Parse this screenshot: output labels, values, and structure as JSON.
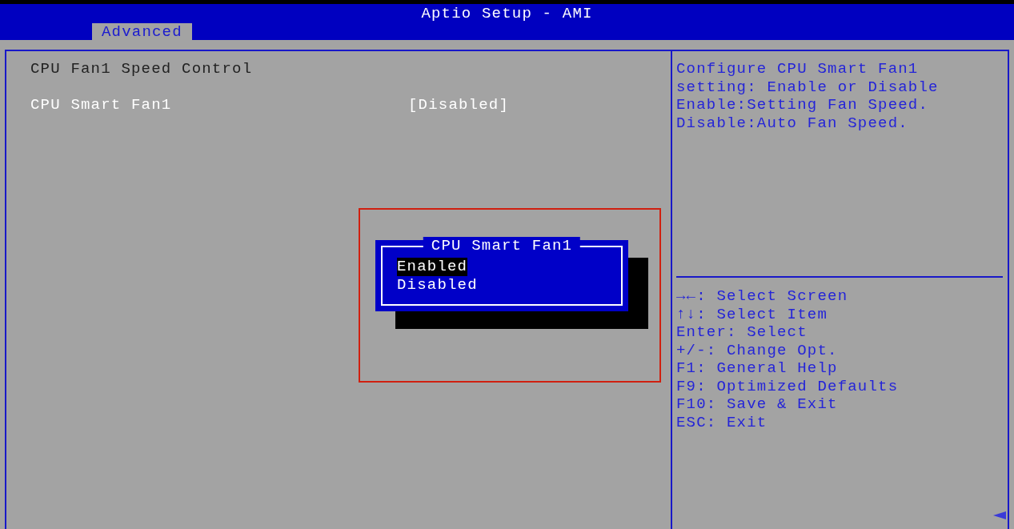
{
  "window": {
    "title": "Aptio Setup - AMI"
  },
  "tabs": [
    {
      "label": "Advanced",
      "selected": true
    }
  ],
  "main": {
    "heading": "CPU Fan1 Speed Control",
    "settings": [
      {
        "label": "CPU Smart Fan1",
        "value": "[Disabled]"
      }
    ]
  },
  "popup": {
    "title": "CPU Smart Fan1",
    "options": [
      {
        "label": "Enabled",
        "selected": true
      },
      {
        "label": "Disabled",
        "selected": false
      }
    ]
  },
  "help": {
    "lines": [
      "Configure CPU Smart Fan1",
      "setting: Enable or Disable",
      "Enable:Setting Fan Speed.",
      "Disable:Auto Fan Speed."
    ]
  },
  "keys": [
    "→←: Select Screen",
    "↑↓: Select Item",
    "Enter: Select",
    "+/-: Change Opt.",
    "F1: General Help",
    "F9: Optimized Defaults",
    "F10: Save & Exit",
    "ESC: Exit"
  ]
}
